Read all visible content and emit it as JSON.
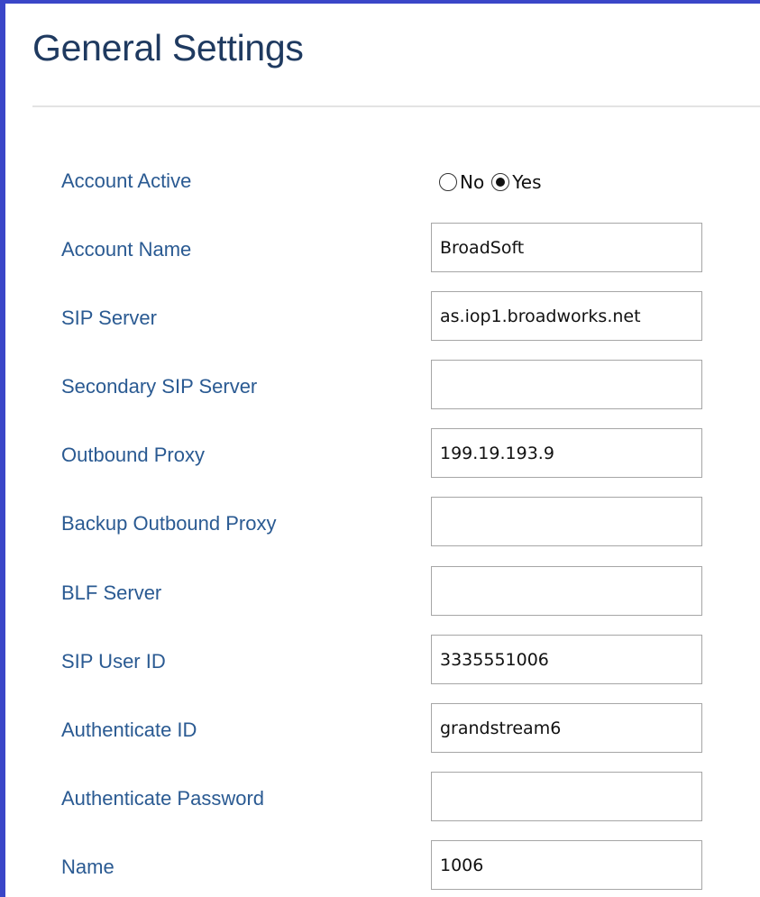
{
  "page": {
    "title": "General Settings"
  },
  "fields": {
    "account_active": {
      "label": "Account Active",
      "options": [
        "No",
        "Yes"
      ],
      "selected": "Yes"
    },
    "account_name": {
      "label": "Account Name",
      "value": "BroadSoft"
    },
    "sip_server": {
      "label": "SIP Server",
      "value": "as.iop1.broadworks.net"
    },
    "secondary_sip_server": {
      "label": "Secondary SIP Server",
      "value": ""
    },
    "outbound_proxy": {
      "label": "Outbound Proxy",
      "value": "199.19.193.9"
    },
    "backup_outbound_proxy": {
      "label": "Backup Outbound Proxy",
      "value": ""
    },
    "blf_server": {
      "label": "BLF Server",
      "value": ""
    },
    "sip_user_id": {
      "label": "SIP User ID",
      "value": "3335551006"
    },
    "authenticate_id": {
      "label": "Authenticate ID",
      "value": "grandstream6"
    },
    "authenticate_password": {
      "label": "Authenticate Password",
      "value": ""
    },
    "name": {
      "label": "Name",
      "value": "1006"
    }
  },
  "colors": {
    "frame_border": "#3a46c8",
    "title": "#1f3a60",
    "label": "#2a5a92",
    "input_border": "#a6a6a6"
  }
}
